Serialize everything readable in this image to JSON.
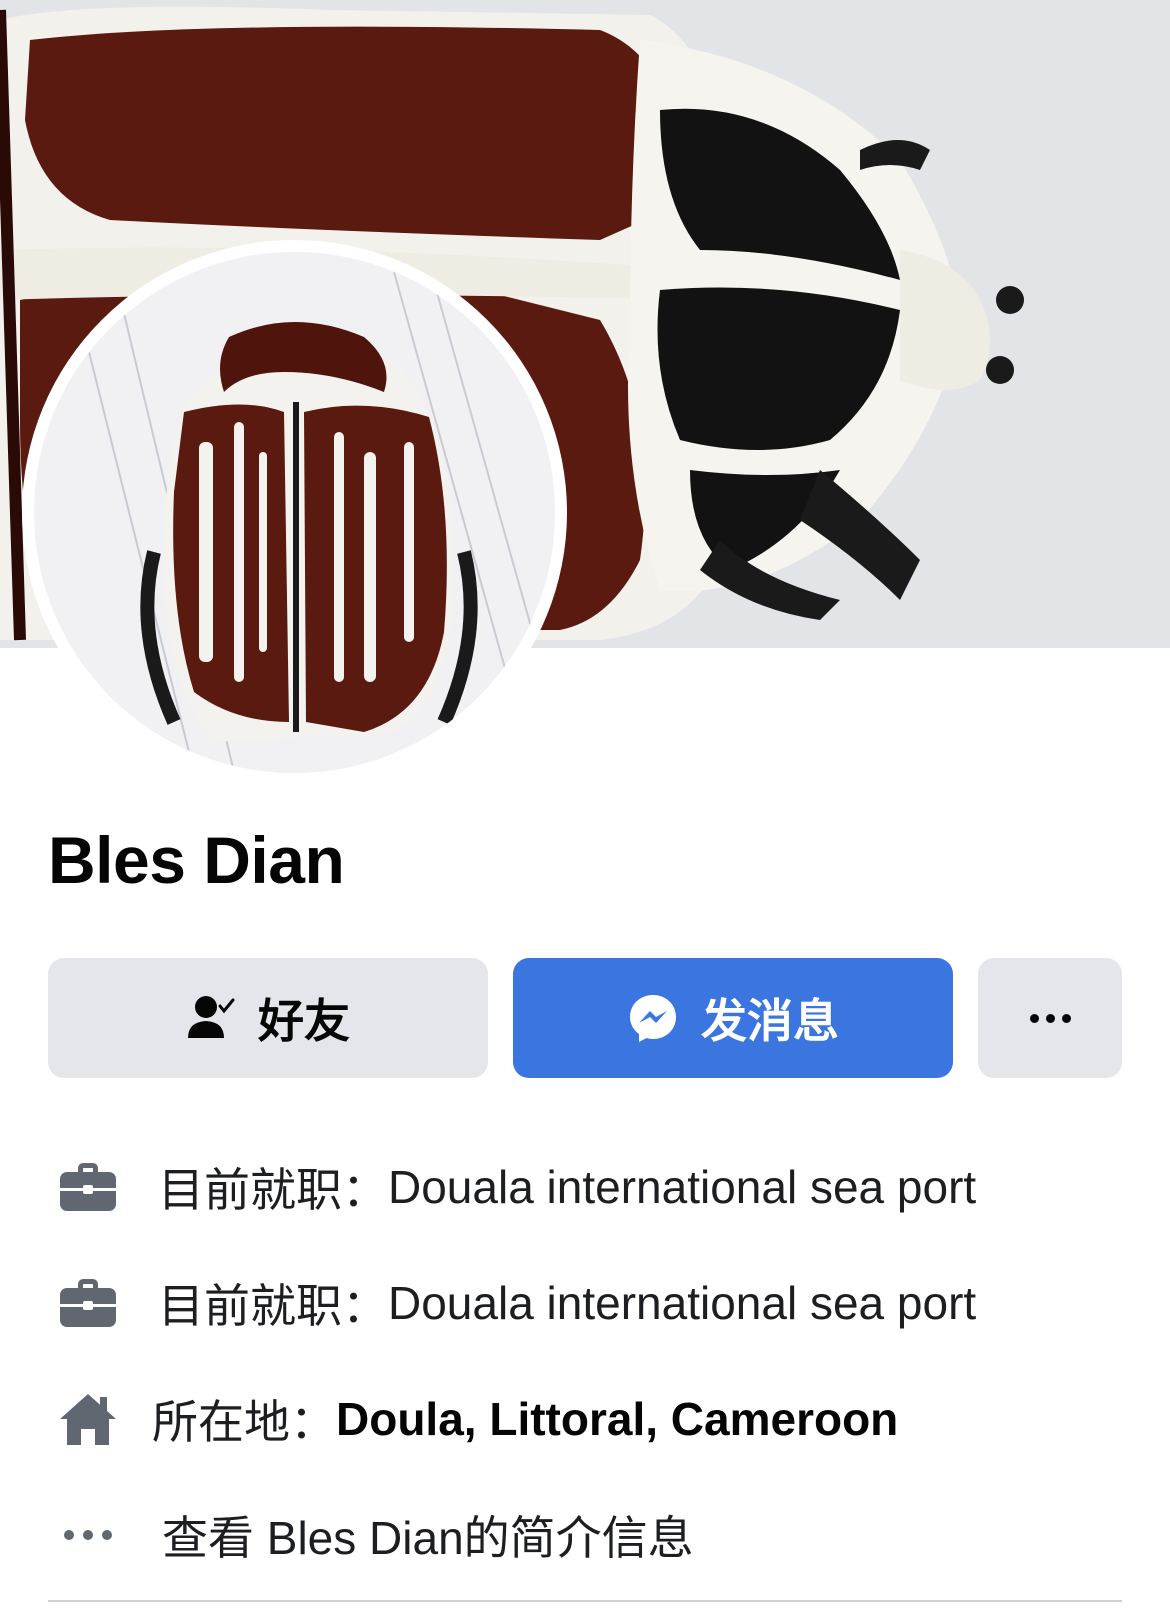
{
  "profile": {
    "name": "Bles Dian"
  },
  "actions": {
    "friend_label": "好友",
    "message_label": "发消息"
  },
  "info": {
    "work_1": {
      "label": "目前就职：",
      "value": "Douala international sea port"
    },
    "work_2": {
      "label": "目前就职：",
      "value": "Douala international sea port"
    },
    "location": {
      "label": "所在地：",
      "value": "Doula, Littoral, Cameroon"
    },
    "about": "查看 Bles Dian的简介信息"
  },
  "icons": {
    "friend": "person-check-icon",
    "message": "messenger-icon",
    "more": "more-horizontal-icon",
    "work": "briefcase-icon",
    "home": "home-icon",
    "about": "more-dots-icon"
  },
  "colors": {
    "primary_button": "#3a75e0",
    "secondary_button": "#e4e6eb",
    "icon": "#606770"
  }
}
